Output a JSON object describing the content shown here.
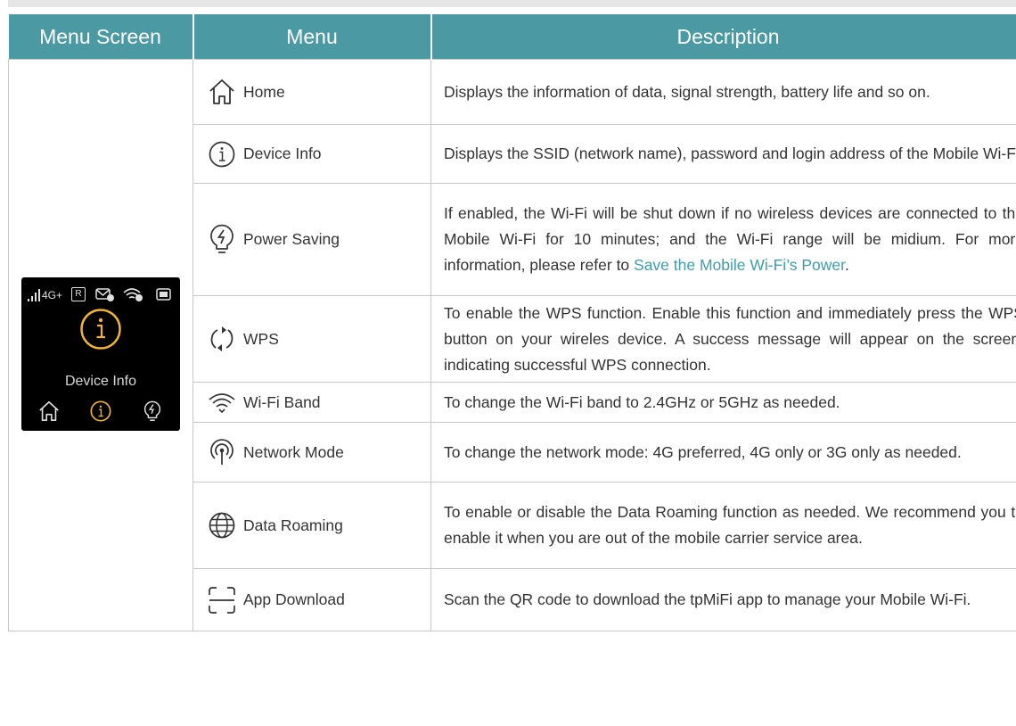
{
  "table": {
    "headers": {
      "screen": "Menu Screen",
      "menu": "Menu",
      "description": "Description"
    },
    "device_screen": {
      "network": "4G+",
      "roaming_badge": "R",
      "title": "Device Info",
      "accent_color": "#f0b431"
    },
    "rows": [
      {
        "icon": "home-icon",
        "label": "Home",
        "description": "Displays the information of data, signal strength, battery life and so on."
      },
      {
        "icon": "info-icon",
        "label": "Device Info",
        "description": "Displays the SSID (network name), password and login address of the Mobile Wi-Fi."
      },
      {
        "icon": "power-saving-icon",
        "label": "Power Saving",
        "description": "If enabled, the Wi-Fi will be shut down if no wireless devices are connected to the Mobile Wi-Fi for 10 minutes; and the Wi-Fi range will be midium. For more information, please refer to ",
        "link": "Save the Mobile Wi-Fi’s Power",
        "suffix": "."
      },
      {
        "icon": "wps-icon",
        "label": "WPS",
        "description": "To enable the WPS function. Enable this function and immediately press the WPS button on your wireles device. A success message will appear on the screen, indicating successful WPS connection."
      },
      {
        "icon": "wifi-icon",
        "label": "Wi-Fi Band",
        "description": "To change the  Wi-Fi band to 2.4GHz or 5GHz as needed."
      },
      {
        "icon": "network-mode-icon",
        "label": "Network Mode",
        "description": "To change the network mode: 4G preferred, 4G only or 3G only as needed."
      },
      {
        "icon": "globe-icon",
        "label": "Data Roaming",
        "description": "To enable or disable the Data Roaming function as needed. We recommend you to enable it when you are out of the mobile carrier service area."
      },
      {
        "icon": "qr-scan-icon",
        "label": "App Download",
        "description": "Scan the QR code to download the tpMiFi app to manage your Mobile Wi-Fi."
      }
    ]
  },
  "colors": {
    "header_bg": "#4a99a3",
    "link": "#3e9dae",
    "border": "#c8c8c8"
  }
}
